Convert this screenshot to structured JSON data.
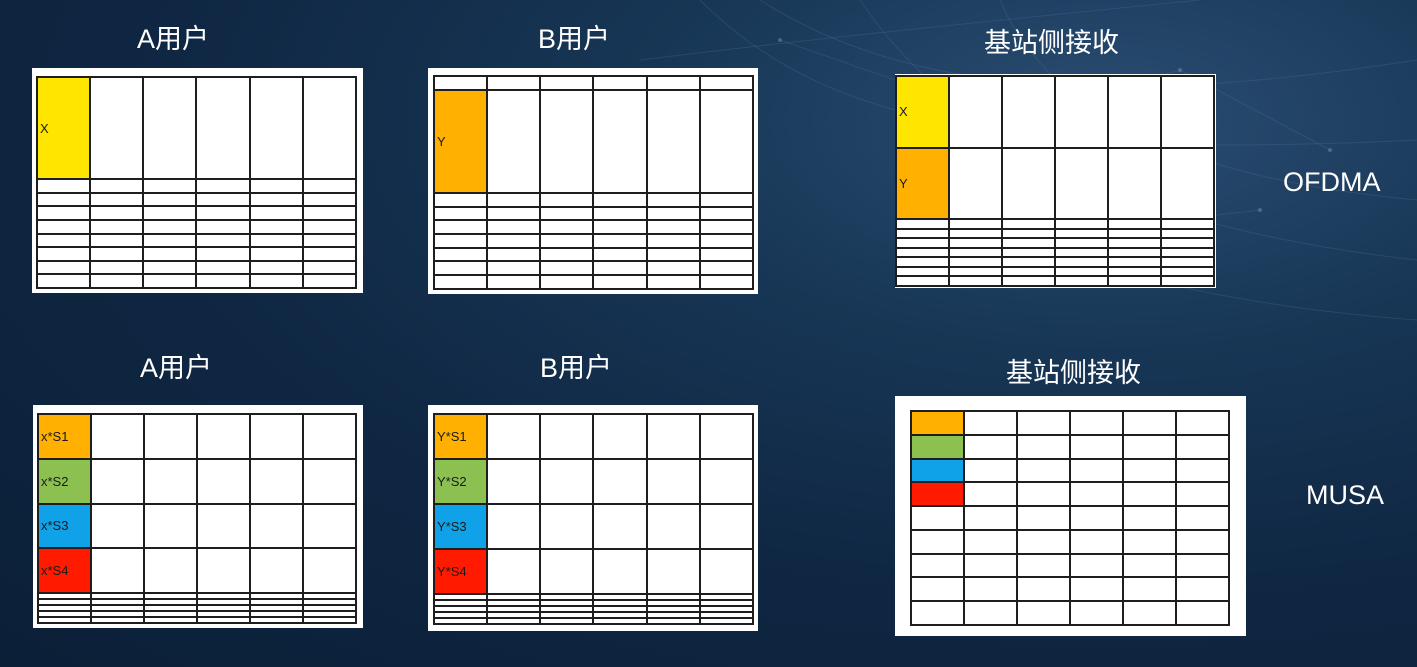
{
  "colors": {
    "yellow": "#ffe600",
    "orange": "#ffb000",
    "green": "#8cc152",
    "blue": "#10a2e8",
    "red": "#ff1a00"
  },
  "rows": {
    "ofdma_label": "OFDMA",
    "musa_label": "MUSA"
  },
  "grids": [
    {
      "id": "ofdma-a",
      "title": "A用户",
      "rows": 9,
      "cols": 6,
      "cells": [
        {
          "row": 0,
          "col": 0,
          "text": "X",
          "color": "#ffe600"
        }
      ]
    },
    {
      "id": "ofdma-b",
      "title": "B用户",
      "rows": 9,
      "cols": 6,
      "cells": [
        {
          "row": 1,
          "col": 0,
          "text": "Y",
          "color": "#ffb000"
        }
      ]
    },
    {
      "id": "ofdma-bs",
      "title": "基站侧接收",
      "rows": 9,
      "cols": 6,
      "cells": [
        {
          "row": 0,
          "col": 0,
          "text": "X",
          "color": "#ffe600"
        },
        {
          "row": 1,
          "col": 0,
          "text": "Y",
          "color": "#ffb000"
        }
      ]
    },
    {
      "id": "musa-a",
      "title": "A用户",
      "rows": 9,
      "cols": 6,
      "cells": [
        {
          "row": 0,
          "col": 0,
          "text": "x*S1",
          "color": "#ffb000"
        },
        {
          "row": 1,
          "col": 0,
          "text": "x*S2",
          "color": "#8cc152"
        },
        {
          "row": 2,
          "col": 0,
          "text": "x*S3",
          "color": "#10a2e8"
        },
        {
          "row": 3,
          "col": 0,
          "text": "x*S4",
          "color": "#ff1a00"
        }
      ]
    },
    {
      "id": "musa-b",
      "title": "B用户",
      "rows": 9,
      "cols": 6,
      "cells": [
        {
          "row": 0,
          "col": 0,
          "text": "Y*S1",
          "color": "#ffb000"
        },
        {
          "row": 1,
          "col": 0,
          "text": "Y*S2",
          "color": "#8cc152"
        },
        {
          "row": 2,
          "col": 0,
          "text": "Y*S3",
          "color": "#10a2e8"
        },
        {
          "row": 3,
          "col": 0,
          "text": "Y*S4",
          "color": "#ff1a00"
        }
      ]
    },
    {
      "id": "musa-bs",
      "title": "基站侧接收",
      "rows": 9,
      "cols": 6,
      "cells": [
        {
          "row": 0,
          "col": 0,
          "text": "",
          "color": "#ffb000"
        },
        {
          "row": 1,
          "col": 0,
          "text": "",
          "color": "#8cc152"
        },
        {
          "row": 2,
          "col": 0,
          "text": "",
          "color": "#10a2e8"
        },
        {
          "row": 3,
          "col": 0,
          "text": "",
          "color": "#ff1a00"
        }
      ]
    }
  ]
}
